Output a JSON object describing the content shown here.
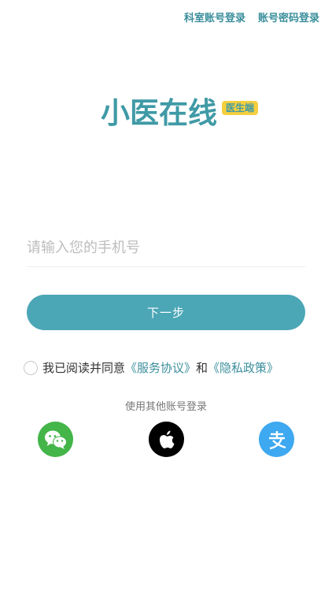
{
  "header": {
    "dept_login": "科室账号登录",
    "password_login": "账号密码登录"
  },
  "logo": {
    "title": "小医在线",
    "badge": "医生端"
  },
  "form": {
    "phone_placeholder": "请输入您的手机号",
    "next_label": "下一步"
  },
  "agreement": {
    "prefix": "我已阅读并同意",
    "service": "《服务协议》",
    "and": "和",
    "privacy": "《隐私政策》"
  },
  "other_login": {
    "label": "使用其他账号登录",
    "providers": [
      "wechat-icon",
      "apple-icon",
      "alipay-icon"
    ]
  },
  "colors": {
    "accent": "#4ba6b6",
    "link": "#3a8e9b",
    "badge": "#f5cf3e",
    "wechat": "#44b549",
    "alipay": "#3ea8f0"
  }
}
